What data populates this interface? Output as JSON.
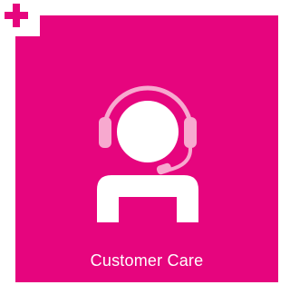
{
  "tile": {
    "label": "Customer Care",
    "icon": "customer-care-headset-icon"
  },
  "badge": {
    "icon": "plus-icon"
  },
  "colors": {
    "brand_magenta": "#e6057e",
    "icon_white": "#ffffff",
    "headset_pink": "#f7a9cf"
  }
}
